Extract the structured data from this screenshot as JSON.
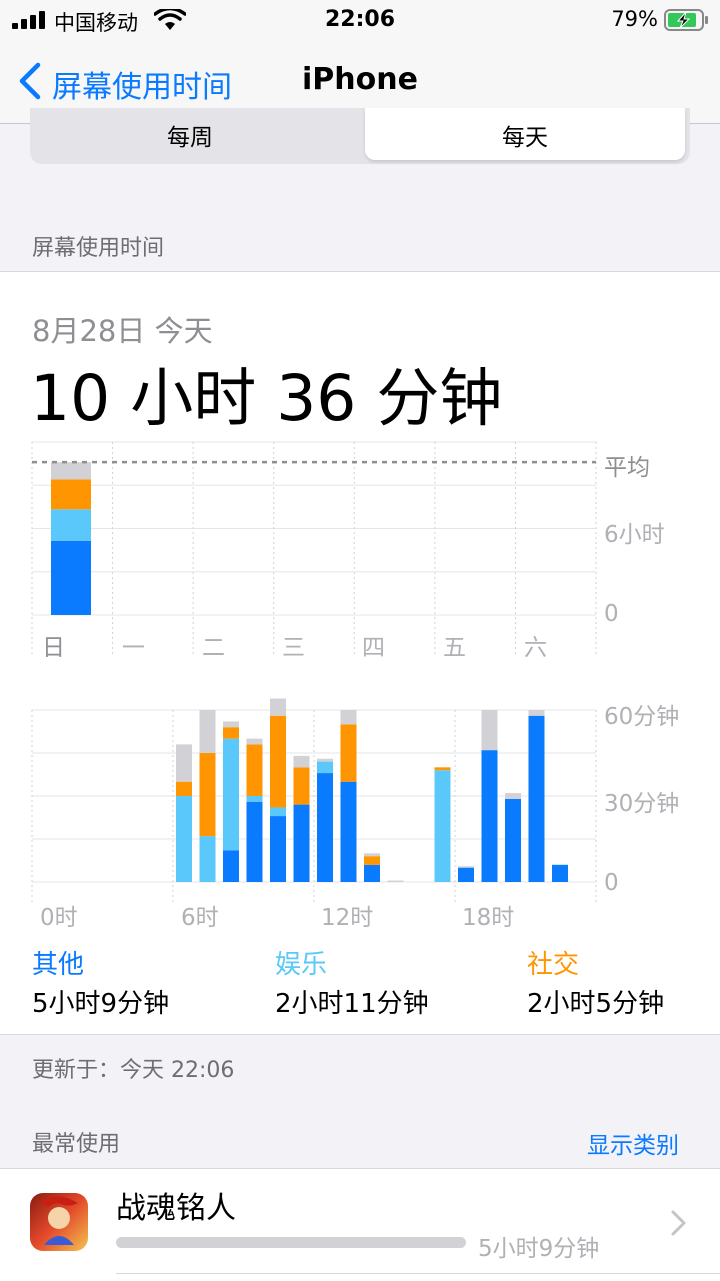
{
  "status_bar": {
    "carrier": "中国移动",
    "time": "22:06",
    "battery": "79%"
  },
  "nav": {
    "back_label": "屏幕使用时间",
    "title": "iPhone"
  },
  "segment": {
    "weekly": "每周",
    "daily": "每天",
    "selected": "daily"
  },
  "section_screen_time": "屏幕使用时间",
  "summary": {
    "date": "8月28日 今天",
    "total": "10 小时 36 分钟"
  },
  "weekly_chart": {
    "days": [
      "日",
      "一",
      "二",
      "三",
      "四",
      "五",
      "六"
    ],
    "avg_label": "平均",
    "y_labels": [
      "6小时",
      "0"
    ]
  },
  "chart_data": [
    {
      "type": "bar",
      "title": "",
      "categories": [
        "日",
        "一",
        "二",
        "三",
        "四",
        "五",
        "六"
      ],
      "series": [
        {
          "name": "其他",
          "values": [
            5.15,
            0,
            0,
            0,
            0,
            0,
            0
          ]
        },
        {
          "name": "娱乐",
          "values": [
            2.18,
            0,
            0,
            0,
            0,
            0,
            0
          ]
        },
        {
          "name": "社交",
          "values": [
            2.08,
            0,
            0,
            0,
            0,
            0,
            0
          ]
        },
        {
          "name": "",
          "values": [
            1.19,
            0,
            0,
            0,
            0,
            0,
            0
          ]
        }
      ],
      "average": 10.6,
      "ylabel": "",
      "ylim": [
        0,
        12
      ],
      "y_ticks": [
        "0",
        "6小时"
      ]
    },
    {
      "type": "bar",
      "title": "",
      "categories": [
        "0",
        "1",
        "2",
        "3",
        "4",
        "5",
        "6",
        "7",
        "8",
        "9",
        "10",
        "11",
        "12",
        "13",
        "14",
        "15",
        "16",
        "17",
        "18",
        "19",
        "20",
        "21",
        "22",
        "23"
      ],
      "x_tick_labels": [
        "0时",
        "6时",
        "12时",
        "18时"
      ],
      "series": [
        {
          "name": "其他",
          "values": [
            0,
            0,
            0,
            0,
            0,
            0,
            0,
            0,
            11,
            28,
            23,
            27,
            38,
            35,
            6,
            0,
            0,
            0,
            5,
            46,
            29,
            58,
            6,
            0
          ]
        },
        {
          "name": "娱乐",
          "values": [
            0,
            0,
            0,
            0,
            0,
            0,
            30,
            16,
            39,
            2,
            3,
            0,
            4,
            0,
            0,
            0,
            0,
            39,
            0,
            0,
            0,
            0,
            0,
            0
          ]
        },
        {
          "name": "社交",
          "values": [
            0,
            0,
            0,
            0,
            0,
            0,
            5,
            29,
            4,
            18,
            32,
            13,
            0,
            20,
            3,
            0,
            0,
            1,
            0,
            0,
            0,
            0,
            0,
            0
          ]
        },
        {
          "name": "",
          "values": [
            0,
            0,
            0,
            0,
            0,
            0,
            13,
            15,
            2,
            2,
            6,
            4,
            1,
            5,
            1,
            0.5,
            0,
            0,
            0.5,
            14,
            2,
            2,
            0,
            0
          ]
        }
      ],
      "ylim": [
        0,
        60
      ],
      "y_ticks": [
        "0",
        "30分钟",
        "60分钟"
      ]
    }
  ],
  "hourly_chart": {
    "y_labels": [
      "60分钟",
      "30分钟",
      "0"
    ],
    "x_labels": [
      "0时",
      "6时",
      "12时",
      "18时"
    ]
  },
  "categories": [
    {
      "name": "其他",
      "value": "5小时9分钟",
      "color": "#0a7aff"
    },
    {
      "name": "娱乐",
      "value": "2小时11分钟",
      "color": "#5ac8fa"
    },
    {
      "name": "社交",
      "value": "2小时5分钟",
      "color": "#ff9500"
    }
  ],
  "updated": "更新于：今天 22:06",
  "most_used": {
    "title": "最常使用",
    "toggle": "显示类别"
  },
  "apps": [
    {
      "name": "战魂铭人",
      "usage": "5小时9分钟",
      "bar_fraction": 1.0
    }
  ],
  "colors": {
    "other": "#0a7aff",
    "entertainment": "#5ac8fa",
    "social": "#ff9500",
    "misc": "#d1d1d6",
    "accent": "#0a7aff"
  }
}
